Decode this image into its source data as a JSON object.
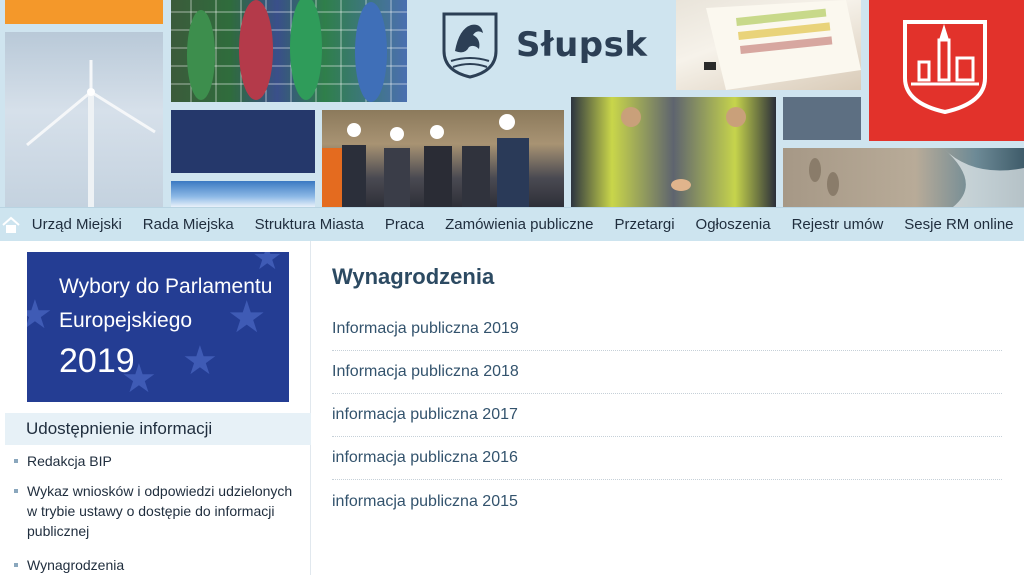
{
  "header": {
    "logo_text": "Słupsk"
  },
  "nav": {
    "home_icon": "home-icon",
    "items": [
      "Urząd Miejski",
      "Rada Miejska",
      "Struktura Miasta",
      "Praca",
      "Zamówienia publiczne",
      "Przetargi",
      "Ogłoszenia",
      "Rejestr umów",
      "Sesje RM online"
    ]
  },
  "sidebar": {
    "banner": {
      "line1": "Wybory do Parlamentu",
      "line2": "Europejskiego",
      "year": "2019"
    },
    "section_title": "Udostępnienie informacji",
    "items": [
      "Redakcja BIP",
      "Wykaz wniosków i odpowiedzi udzielonych w trybie ustawy o dostępie do informacji publicznej",
      "Wynagrodzenia"
    ]
  },
  "main": {
    "title": "Wynagrodzenia",
    "links": [
      "Informacja publiczna 2019",
      "Informacja publiczna 2018",
      "informacja publiczna 2017",
      "informacja publiczna 2016",
      "informacja publiczna 2015"
    ]
  },
  "colors": {
    "nav_bg": "#cde4ef",
    "banner_bg": "#243d93",
    "accent_red": "#e2322b",
    "accent_orange": "#f4982a"
  }
}
